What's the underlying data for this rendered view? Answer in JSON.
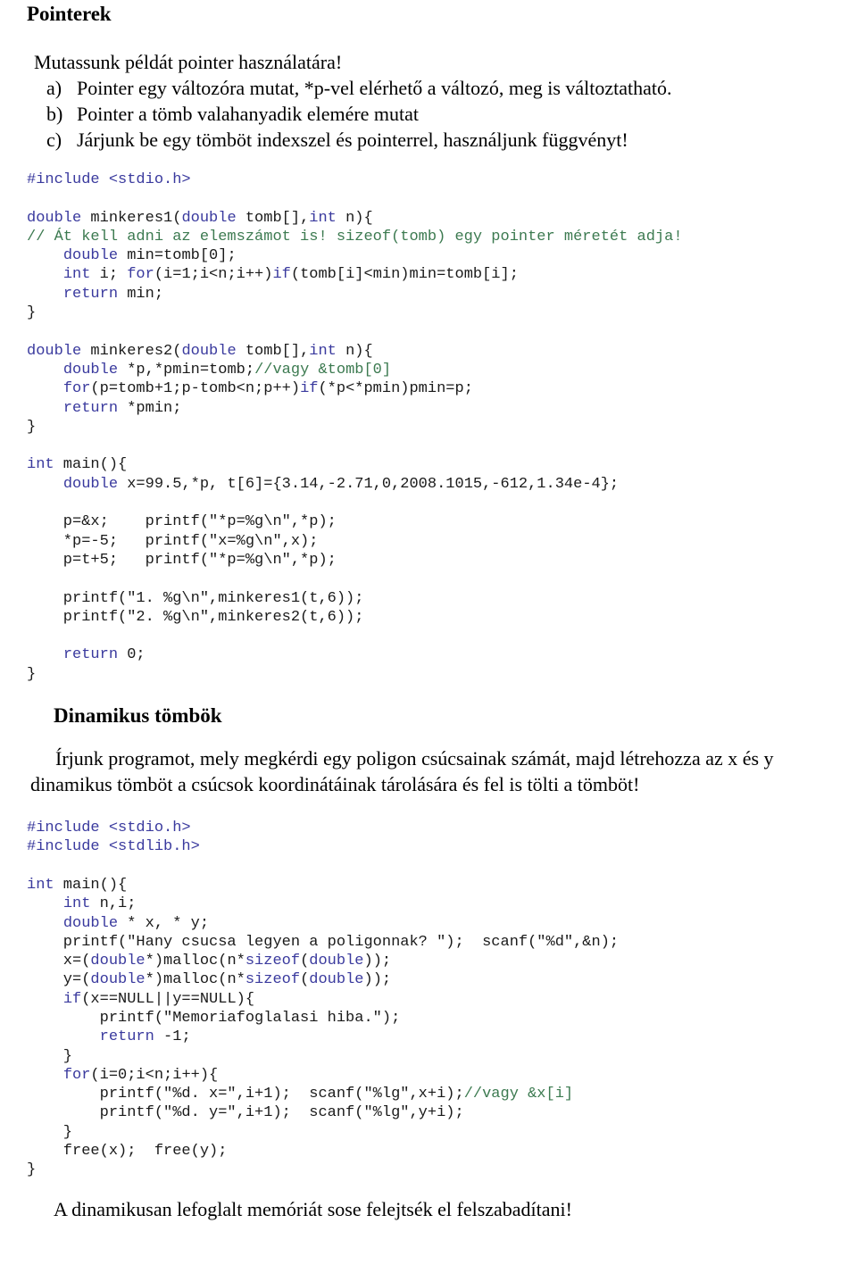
{
  "document": {
    "title": "Pointerek",
    "lead": "Mutassunk példát pointer használatára!",
    "list": [
      {
        "marker": "a)",
        "text": "Pointer egy változóra mutat, *p-vel elérhető a változó, meg is változtatható."
      },
      {
        "marker": "b)",
        "text": "Pointer a tömb valahanyadik elemére mutat"
      },
      {
        "marker": "c)",
        "text": "Járjunk be egy tömböt indexszel és pointerrel, használjunk függvényt!"
      }
    ],
    "section2_title": "Dinamikus tömbök",
    "section2_paragraph": "Írjunk programot, mely megkérdi egy poligon csúcsainak számát, majd létrehozza az x és y dinamikus tömböt a csúcsok koordinátáinak tárolására és fel is tölti a tömböt!",
    "closing_note": "A dinamikusan lefoglalt memóriát sose felejtsék el felszabadítani!"
  },
  "code_blocks": {
    "pointers_example": [
      [
        {
          "t": "#include <stdio.h>",
          "c": "kw"
        }
      ],
      [
        {
          "t": "",
          "c": "pl"
        }
      ],
      [
        {
          "t": "double",
          "c": "kw"
        },
        {
          "t": " minkeres1(",
          "c": "pl"
        },
        {
          "t": "double",
          "c": "kw"
        },
        {
          "t": " tomb[],",
          "c": "pl"
        },
        {
          "t": "int",
          "c": "kw"
        },
        {
          "t": " n){",
          "c": "pl"
        }
      ],
      [
        {
          "t": "// Át kell adni az elemszámot is! sizeof(tomb) egy pointer méretét adja!",
          "c": "cm"
        }
      ],
      [
        {
          "t": "    ",
          "c": "pl"
        },
        {
          "t": "double",
          "c": "kw"
        },
        {
          "t": " min=tomb[0];",
          "c": "pl"
        }
      ],
      [
        {
          "t": "    ",
          "c": "pl"
        },
        {
          "t": "int",
          "c": "kw"
        },
        {
          "t": " i; ",
          "c": "pl"
        },
        {
          "t": "for",
          "c": "kw"
        },
        {
          "t": "(i=1;i<n;i++)",
          "c": "pl"
        },
        {
          "t": "if",
          "c": "kw"
        },
        {
          "t": "(tomb[i]<min)min=tomb[i];",
          "c": "pl"
        }
      ],
      [
        {
          "t": "    ",
          "c": "pl"
        },
        {
          "t": "return",
          "c": "kw"
        },
        {
          "t": " min;",
          "c": "pl"
        }
      ],
      [
        {
          "t": "}",
          "c": "pl"
        }
      ],
      [
        {
          "t": "",
          "c": "pl"
        }
      ],
      [
        {
          "t": "double",
          "c": "kw"
        },
        {
          "t": " minkeres2(",
          "c": "pl"
        },
        {
          "t": "double",
          "c": "kw"
        },
        {
          "t": " tomb[],",
          "c": "pl"
        },
        {
          "t": "int",
          "c": "kw"
        },
        {
          "t": " n){",
          "c": "pl"
        }
      ],
      [
        {
          "t": "    ",
          "c": "pl"
        },
        {
          "t": "double",
          "c": "kw"
        },
        {
          "t": " *p,*pmin=tomb;",
          "c": "pl"
        },
        {
          "t": "//vagy &tomb[0]",
          "c": "cm"
        }
      ],
      [
        {
          "t": "    ",
          "c": "pl"
        },
        {
          "t": "for",
          "c": "kw"
        },
        {
          "t": "(p=tomb+1;p-tomb<n;p++)",
          "c": "pl"
        },
        {
          "t": "if",
          "c": "kw"
        },
        {
          "t": "(*p<*pmin)pmin=p;",
          "c": "pl"
        }
      ],
      [
        {
          "t": "    ",
          "c": "pl"
        },
        {
          "t": "return",
          "c": "kw"
        },
        {
          "t": " *pmin;",
          "c": "pl"
        }
      ],
      [
        {
          "t": "}",
          "c": "pl"
        }
      ],
      [
        {
          "t": "",
          "c": "pl"
        }
      ],
      [
        {
          "t": "int",
          "c": "kw"
        },
        {
          "t": " main(){",
          "c": "pl"
        }
      ],
      [
        {
          "t": "    ",
          "c": "pl"
        },
        {
          "t": "double",
          "c": "kw"
        },
        {
          "t": " x=99.5,*p, t[6]={3.14,-2.71,0,2008.1015,-612,1.34e-4};",
          "c": "pl"
        }
      ],
      [
        {
          "t": "",
          "c": "pl"
        }
      ],
      [
        {
          "t": "    p=&x;    printf(\"*p=%g\\n\",*p);",
          "c": "pl"
        }
      ],
      [
        {
          "t": "    *p=-5;   printf(\"x=%g\\n\",x);",
          "c": "pl"
        }
      ],
      [
        {
          "t": "    p=t+5;   printf(\"*p=%g\\n\",*p);",
          "c": "pl"
        }
      ],
      [
        {
          "t": "",
          "c": "pl"
        }
      ],
      [
        {
          "t": "    printf(\"1. %g\\n\",minkeres1(t,6));",
          "c": "pl"
        }
      ],
      [
        {
          "t": "    printf(\"2. %g\\n\",minkeres2(t,6));",
          "c": "pl"
        }
      ],
      [
        {
          "t": "",
          "c": "pl"
        }
      ],
      [
        {
          "t": "    ",
          "c": "pl"
        },
        {
          "t": "return",
          "c": "kw"
        },
        {
          "t": " 0;",
          "c": "pl"
        }
      ],
      [
        {
          "t": "}",
          "c": "pl"
        }
      ]
    ],
    "dynamic_arrays_example": [
      [
        {
          "t": "#include <stdio.h>",
          "c": "kw"
        }
      ],
      [
        {
          "t": "#include <stdlib.h>",
          "c": "kw"
        }
      ],
      [
        {
          "t": "",
          "c": "pl"
        }
      ],
      [
        {
          "t": "int",
          "c": "kw"
        },
        {
          "t": " main(){",
          "c": "pl"
        }
      ],
      [
        {
          "t": "    ",
          "c": "pl"
        },
        {
          "t": "int",
          "c": "kw"
        },
        {
          "t": " n,i;",
          "c": "pl"
        }
      ],
      [
        {
          "t": "    ",
          "c": "pl"
        },
        {
          "t": "double",
          "c": "kw"
        },
        {
          "t": " * x, * y;",
          "c": "pl"
        }
      ],
      [
        {
          "t": "    printf(\"Hany csucsa legyen a poligonnak? \");  scanf(\"%d\",&n);",
          "c": "pl"
        }
      ],
      [
        {
          "t": "    x=(",
          "c": "pl"
        },
        {
          "t": "double",
          "c": "kw"
        },
        {
          "t": "*)malloc(n*",
          "c": "pl"
        },
        {
          "t": "sizeof",
          "c": "kw"
        },
        {
          "t": "(",
          "c": "pl"
        },
        {
          "t": "double",
          "c": "kw"
        },
        {
          "t": "));",
          "c": "pl"
        }
      ],
      [
        {
          "t": "    y=(",
          "c": "pl"
        },
        {
          "t": "double",
          "c": "kw"
        },
        {
          "t": "*)malloc(n*",
          "c": "pl"
        },
        {
          "t": "sizeof",
          "c": "kw"
        },
        {
          "t": "(",
          "c": "pl"
        },
        {
          "t": "double",
          "c": "kw"
        },
        {
          "t": "));",
          "c": "pl"
        }
      ],
      [
        {
          "t": "    ",
          "c": "pl"
        },
        {
          "t": "if",
          "c": "kw"
        },
        {
          "t": "(x==NULL||y==NULL){",
          "c": "pl"
        }
      ],
      [
        {
          "t": "        printf(\"Memoriafoglalasi hiba.\");",
          "c": "pl"
        }
      ],
      [
        {
          "t": "        ",
          "c": "pl"
        },
        {
          "t": "return",
          "c": "kw"
        },
        {
          "t": " -1;",
          "c": "pl"
        }
      ],
      [
        {
          "t": "    }",
          "c": "pl"
        }
      ],
      [
        {
          "t": "    ",
          "c": "pl"
        },
        {
          "t": "for",
          "c": "kw"
        },
        {
          "t": "(i=0;i<n;i++){",
          "c": "pl"
        }
      ],
      [
        {
          "t": "        printf(\"%d. x=\",i+1);  scanf(\"%lg\",x+i);",
          "c": "pl"
        },
        {
          "t": "//vagy &x[i]",
          "c": "cm"
        }
      ],
      [
        {
          "t": "        printf(\"%d. y=\",i+1);  scanf(\"%lg\",y+i);",
          "c": "pl"
        }
      ],
      [
        {
          "t": "    }",
          "c": "pl"
        }
      ],
      [
        {
          "t": "    free(x);  free(y);",
          "c": "pl"
        }
      ],
      [
        {
          "t": "}",
          "c": "pl"
        }
      ]
    ]
  },
  "colors": {
    "keyword": "#3a3a9e",
    "comment": "#3c7a50",
    "plain": "#1a1a1a",
    "background": "#ffffff"
  }
}
